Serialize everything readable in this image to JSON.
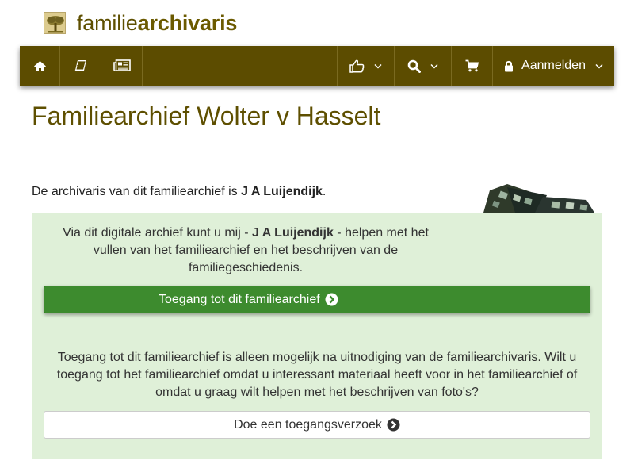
{
  "brand": {
    "name_light": "familie",
    "name_bold": "archivaris",
    "logo_icon": "tree-icon"
  },
  "nav": {
    "home_icon": "home-icon",
    "book_icon": "book-icon",
    "news_icon": "newspaper-icon",
    "like_icon": "thumbs-up-icon",
    "search_icon": "search-icon",
    "cart_icon": "shopping-cart-icon",
    "lock_icon": "lock-icon",
    "login_label": "Aanmelden"
  },
  "page": {
    "title": "Familiearchief Wolter v Hasselt",
    "intro_prefix": "De archivaris van dit familiearchief is ",
    "archivist_name": "J A Luijendijk",
    "intro_suffix": "."
  },
  "panel": {
    "text1_prefix": "Via dit digitale archief kunt u mij - ",
    "text1_name": "J A Luijendijk",
    "text1_suffix": " - helpen met het vullen van het familiearchief en het beschrijven van de familiegeschiedenis.",
    "access_button_label": "Toegang tot dit familiearchief",
    "text2": "Toegang tot dit familiearchief is alleen mogelijk na uitnodiging van de familiearchivaris. Wilt u toegang tot het familiearchief omdat u interessant materiaal heeft voor in het familiearchief of omdat u graag wilt helpen met het beschrijven van foto's?",
    "request_button_label": "Doe een toegangsverzoek"
  },
  "colors": {
    "brand": "#5c4c00",
    "panel_bg": "#dff0d8",
    "success": "#3d8b2e"
  }
}
